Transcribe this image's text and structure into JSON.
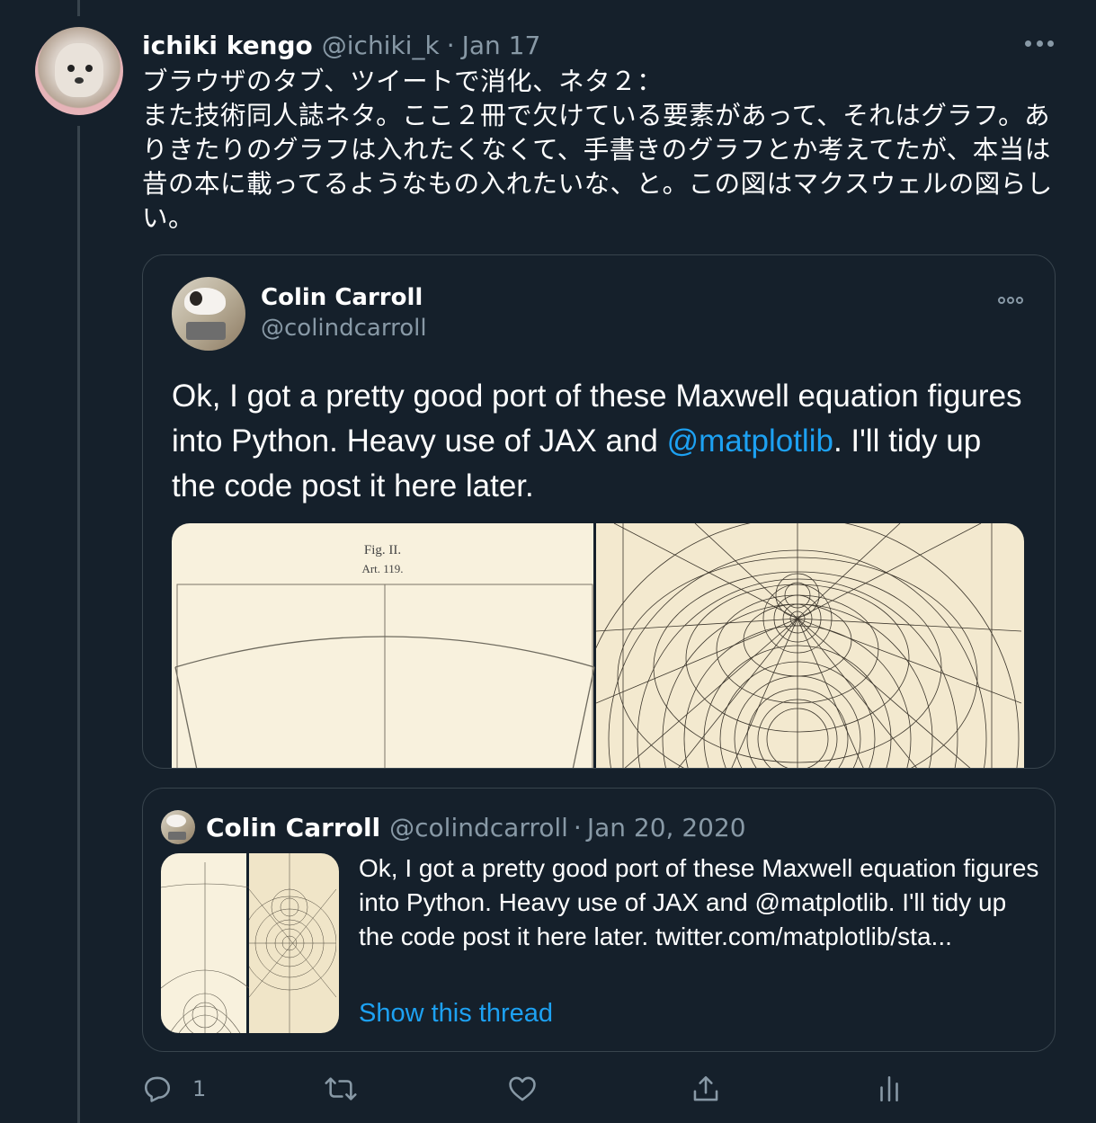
{
  "tweet": {
    "author_name": "ichiki kengo",
    "author_handle": "@ichiki_k",
    "separator": "·",
    "date": "Jan 17",
    "text": "ブラウザのタブ、ツイートで消化、ネタ２：\nまた技術同人誌ネタ。ここ２冊で欠けている要素があって、それはグラフ。ありきたりのグラフは入れたくなくて、手書きのグラフとか考えてたが、本当は昔の本に載ってるようなもの入れたいな、と。この図はマクスウェルの図らしい。"
  },
  "quote": {
    "author_name": "Colin Carroll",
    "author_handle": "@colindcarroll",
    "text_before": "Ok, I got a pretty good port of these Maxwell equation figures into Python. Heavy use of JAX and ",
    "mention": "@matplotlib",
    "text_after": ". I'll tidy up the code post it here later.",
    "figure_caption_1": "Fig. II.",
    "figure_caption_2": "Art. 119."
  },
  "nested_quote": {
    "author_name": "Colin Carroll",
    "author_handle": "@colindcarroll",
    "separator": "·",
    "date": "Jan 20, 2020",
    "text": "Ok, I got a pretty good port of these Maxwell equation figures into Python. Heavy use of JAX and @matplotlib. I'll tidy up the code post it here later. twitter.com/matplotlib/sta...",
    "show_thread": "Show this thread"
  },
  "actions": {
    "reply_count": "1",
    "icons": [
      "reply-icon",
      "retweet-icon",
      "like-icon",
      "share-icon",
      "analytics-icon"
    ]
  },
  "colors": {
    "background": "#15202b",
    "border": "#38444d",
    "secondary_text": "#8899a6",
    "link": "#1da1f2"
  }
}
